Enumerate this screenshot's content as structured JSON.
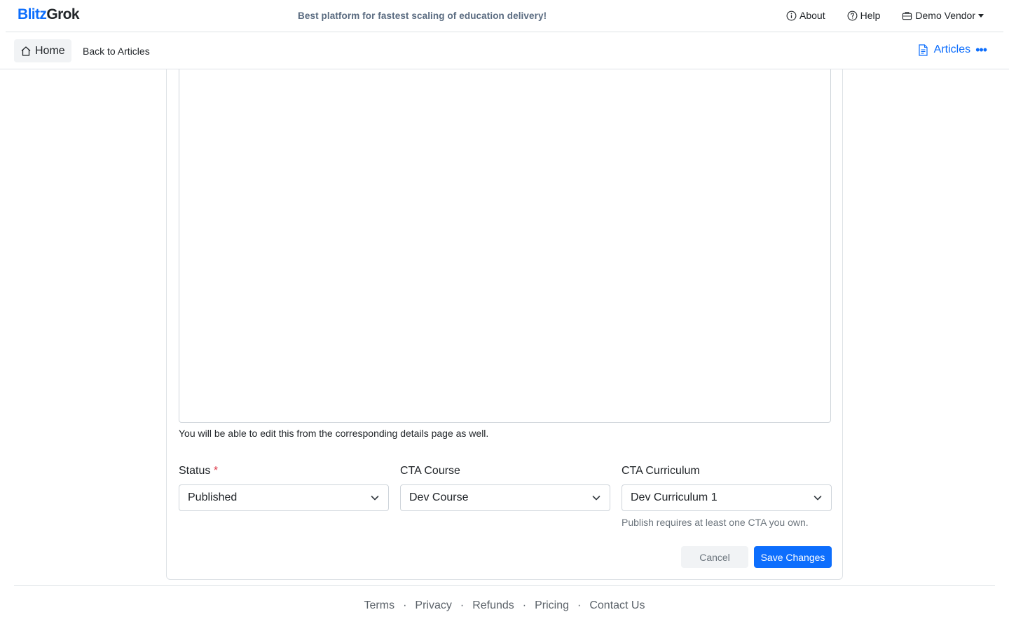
{
  "brand": {
    "part1": "Blitz",
    "part2": "Grok",
    "color": "#0d6efd"
  },
  "tagline": "Best platform for fastest scaling of education delivery!",
  "topnav": {
    "about": "About",
    "help": "Help",
    "account": "Demo Vendor"
  },
  "subnav": {
    "home": "Home",
    "back": "Back to Articles",
    "section": "Articles"
  },
  "form": {
    "editor_help": "You will be able to edit this from the corresponding details page as well.",
    "status": {
      "label": "Status",
      "required": "*",
      "value": "Published"
    },
    "cta_course": {
      "label": "CTA Course",
      "value": "Dev Course"
    },
    "cta_curriculum": {
      "label": "CTA Curriculum",
      "value": "Dev Curriculum 1",
      "help": "Publish requires at least one CTA you own."
    },
    "cancel": "Cancel",
    "save": "Save Changes"
  },
  "footer": {
    "links": [
      "Terms",
      "Privacy",
      "Refunds",
      "Pricing",
      "Contact Us"
    ],
    "separator": "·"
  },
  "colors": {
    "primary": "#0d6efd",
    "danger": "#dc3545",
    "muted": "#6c757d"
  }
}
